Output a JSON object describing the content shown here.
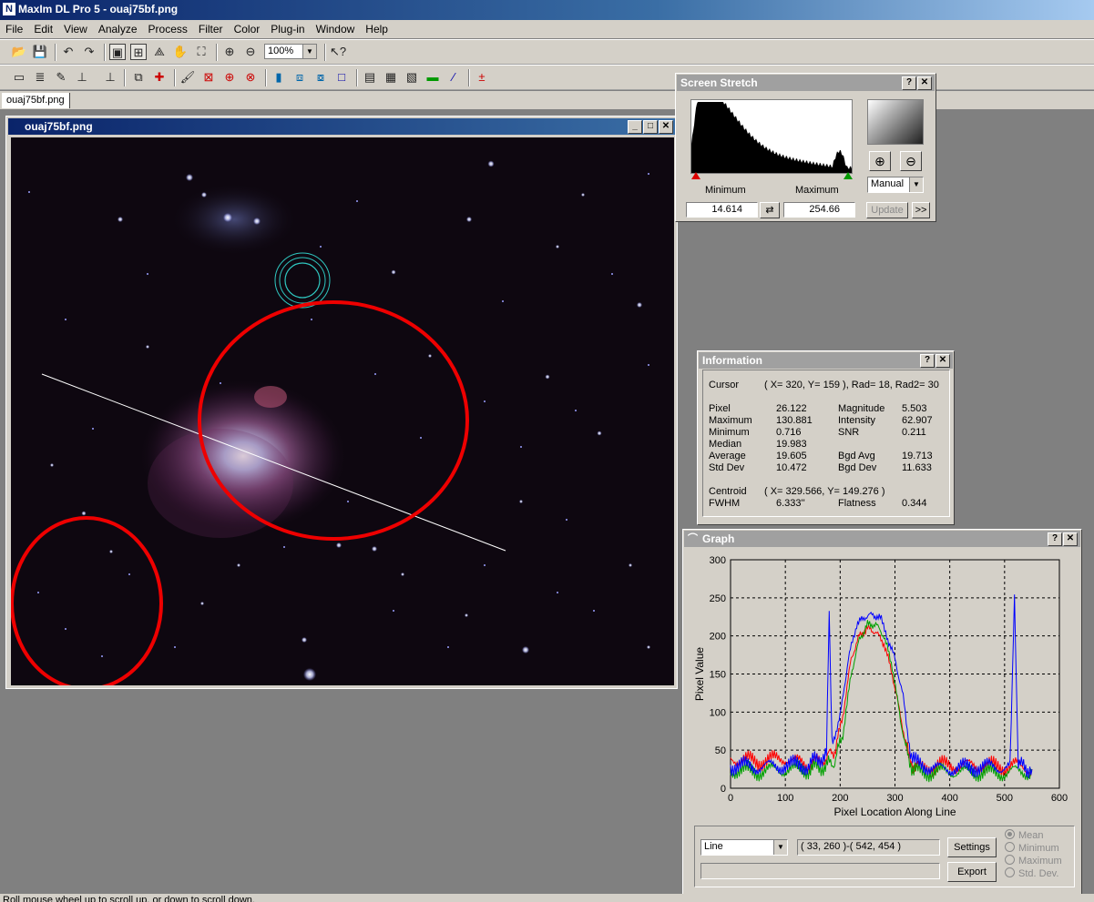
{
  "app": {
    "title": "MaxIm DL Pro 5 - ouaj75bf.png"
  },
  "menu": [
    "File",
    "Edit",
    "View",
    "Analyze",
    "Process",
    "Filter",
    "Color",
    "Plug-in",
    "Window",
    "Help"
  ],
  "toolbar": {
    "zoom_value": "100%"
  },
  "tab": {
    "label": "ouaj75bf.png"
  },
  "image_window": {
    "title": "ouaj75bf.png"
  },
  "screen_stretch": {
    "title": "Screen Stretch",
    "minimum_label": "Minimum",
    "maximum_label": "Maximum",
    "minimum_value": "14.614",
    "maximum_value": "254.66",
    "mode": "Manual",
    "update_label": "Update",
    "more_label": ">>",
    "histogram_color": "#000000"
  },
  "information": {
    "title": "Information",
    "cursor_label": "Cursor",
    "cursor_value": "( X=  320, Y=  159 ), Rad= 18, Rad2= 30",
    "rows": [
      {
        "l1": "Pixel",
        "v1": "26.122",
        "l2": "Magnitude",
        "v2": "5.503"
      },
      {
        "l1": "Maximum",
        "v1": "130.881",
        "l2": "Intensity",
        "v2": "62.907"
      },
      {
        "l1": "Minimum",
        "v1": "0.716",
        "l2": "SNR",
        "v2": "0.211"
      },
      {
        "l1": "Median",
        "v1": "19.983",
        "l2": "",
        "v2": ""
      },
      {
        "l1": "Average",
        "v1": "19.605",
        "l2": "Bgd Avg",
        "v2": "19.713"
      },
      {
        "l1": "Std Dev",
        "v1": "10.472",
        "l2": "Bgd Dev",
        "v2": "11.633"
      }
    ],
    "centroid_label": "Centroid",
    "centroid_value": "( X=  329.566, Y=  149.276 )",
    "fwhm_label": "FWHM",
    "fwhm_value": "6.333''",
    "flatness_label": "Flatness",
    "flatness_value": "0.344"
  },
  "graph": {
    "title": "Graph",
    "mode": "Line",
    "coords": "( 33, 260 )-( 542, 454 )",
    "settings_label": "Settings",
    "export_label": "Export",
    "radio": [
      {
        "label": "Mean",
        "checked": true
      },
      {
        "label": "Minimum",
        "checked": false
      },
      {
        "label": "Maximum",
        "checked": false
      },
      {
        "label": "Std. Dev.",
        "checked": false
      }
    ]
  },
  "chart_data": {
    "type": "line",
    "xlabel": "Pixel Location Along Line",
    "ylabel": "Pixel Value",
    "xlim": [
      0,
      600
    ],
    "ylim": [
      0,
      300
    ],
    "xticks": [
      "0",
      "100",
      "200",
      "300",
      "400",
      "500",
      "600"
    ],
    "yticks": [
      "0",
      "50",
      "100",
      "150",
      "200",
      "250",
      "300"
    ],
    "grid": true,
    "series": [
      {
        "color": "#ff0000",
        "x": [
          0,
          50,
          100,
          140,
          175,
          190,
          205,
          220,
          235,
          250,
          265,
          280,
          295,
          310,
          325,
          340,
          380,
          450,
          500,
          520,
          550
        ],
        "y": [
          40,
          35,
          40,
          30,
          40,
          50,
          95,
          170,
          200,
          210,
          205,
          190,
          150,
          95,
          40,
          25,
          30,
          30,
          28,
          30,
          25
        ]
      },
      {
        "color": "#00a000",
        "x": [
          0,
          50,
          100,
          140,
          175,
          190,
          205,
          220,
          235,
          250,
          265,
          280,
          295,
          310,
          325,
          340,
          380,
          450,
          500,
          520,
          550
        ],
        "y": [
          25,
          22,
          25,
          25,
          30,
          35,
          70,
          150,
          195,
          215,
          215,
          200,
          160,
          90,
          35,
          22,
          22,
          22,
          20,
          22,
          22
        ]
      },
      {
        "color": "#0000ff",
        "x": [
          0,
          50,
          100,
          140,
          175,
          180,
          185,
          200,
          215,
          230,
          245,
          260,
          275,
          285,
          300,
          315,
          330,
          380,
          450,
          510,
          518,
          525,
          550
        ],
        "y": [
          30,
          28,
          30,
          30,
          45,
          235,
          55,
          95,
          170,
          215,
          225,
          228,
          222,
          200,
          170,
          120,
          35,
          25,
          28,
          28,
          250,
          30,
          25
        ]
      }
    ]
  },
  "status": {
    "text": "Roll mouse wheel up to scroll up, or down to scroll down."
  }
}
